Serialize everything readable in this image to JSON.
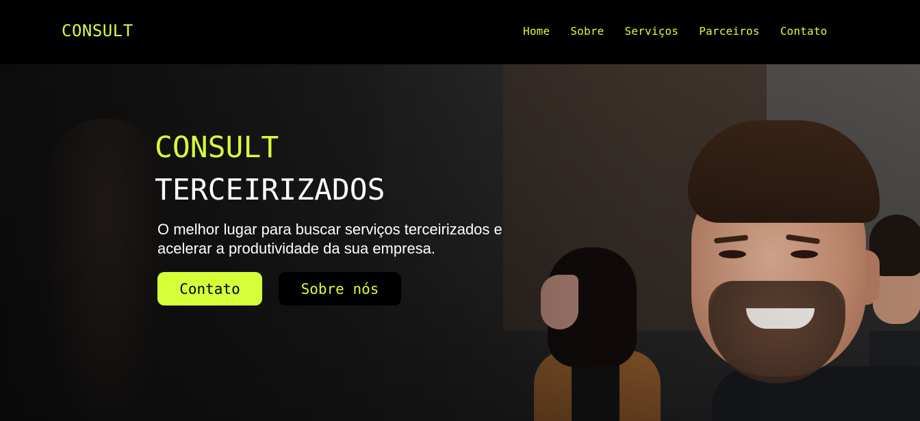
{
  "header": {
    "logo": "CONSULT",
    "nav": [
      "Home",
      "Sobre",
      "Serviços",
      "Parceiros",
      "Contato"
    ]
  },
  "hero": {
    "title_accent": "CONSULT",
    "title_main": "TERCEIRIZADOS",
    "description": "O melhor lugar para buscar serviços terceirizados e acelerar a produtividade da sua empresa.",
    "primary_button": "Contato",
    "secondary_button": "Sobre nós"
  },
  "colors": {
    "accent": "#d6ff3a",
    "background": "#000000",
    "text": "#ffffff"
  }
}
